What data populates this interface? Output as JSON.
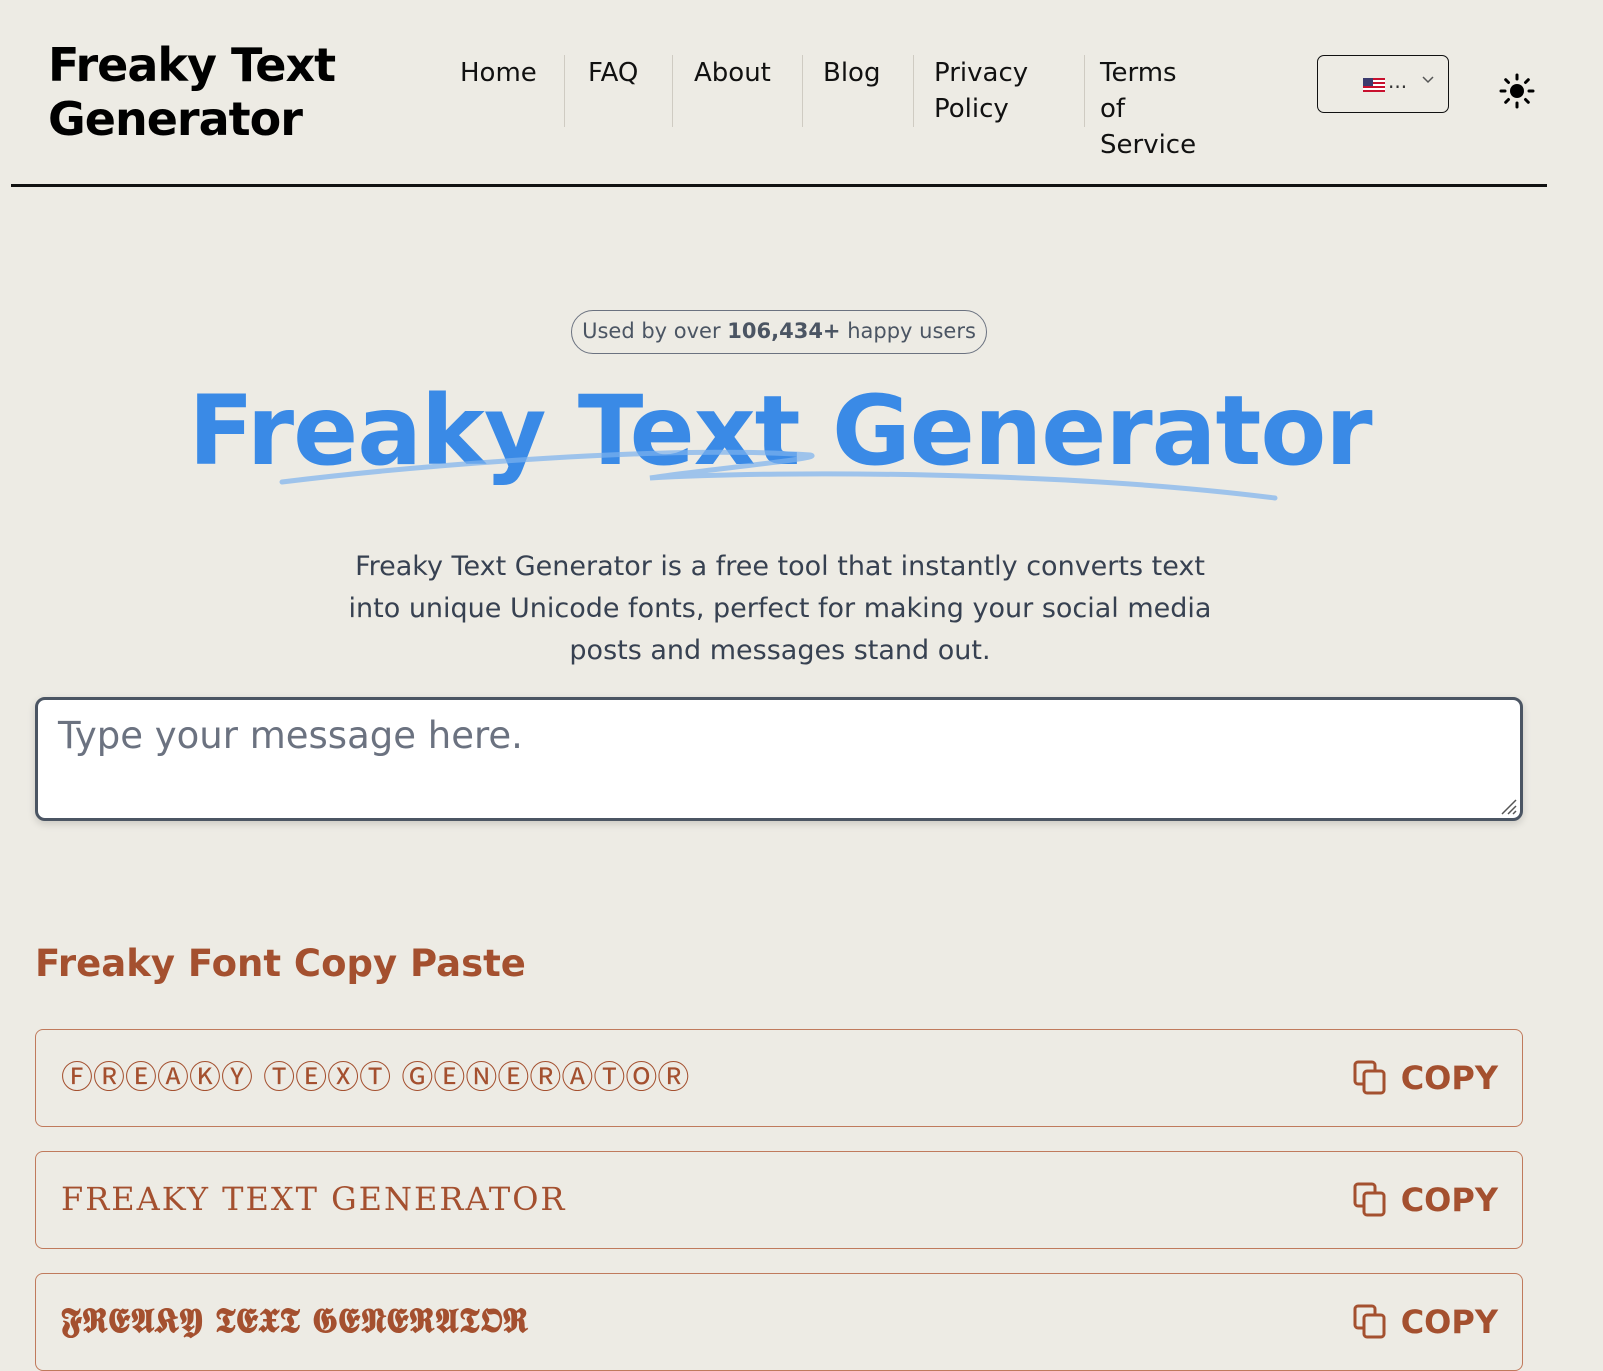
{
  "header": {
    "logo": "Freaky Text\nGenerator",
    "nav": [
      {
        "label": "Home"
      },
      {
        "label": "FAQ"
      },
      {
        "label": "About"
      },
      {
        "label": "Blog"
      },
      {
        "label": "Privacy\nPolicy"
      },
      {
        "label": "Terms of\nService"
      }
    ],
    "language": {
      "flag": "us-flag-icon",
      "ellipsis": "..."
    },
    "theme_icon": "sun-icon"
  },
  "hero": {
    "badge_prefix": "Used by over ",
    "badge_count": "106,434+",
    "badge_suffix": " happy users",
    "title": "Freaky Text Generator",
    "description": "Freaky Text Generator is a free tool that instantly converts text into unique Unicode fonts, perfect for making your social media posts and messages stand out."
  },
  "input": {
    "placeholder": "Type your message here.",
    "value": ""
  },
  "fonts_section": {
    "title": "Freaky Font Copy Paste",
    "copy_label": "COPY",
    "rows": [
      {
        "text": "ⒻⓇⒺⒶⓀⓎ ⓉⒺⓍⓉ ⒼⒺⓃⒺⓇⒶⓉⓄⓇ"
      },
      {
        "text": "FREAKY TEXT GENERATOR"
      },
      {
        "text": "𝕱𝕽𝕰𝕬𝕶𝖄 𝕿𝕰𝖃𝕿 𝕲𝕰𝕹𝕰𝕽𝕬𝕿𝕺𝕽"
      }
    ]
  },
  "colors": {
    "accent_blue": "#3a8ae6",
    "rust": "#a4502f",
    "background": "#edebe4"
  }
}
